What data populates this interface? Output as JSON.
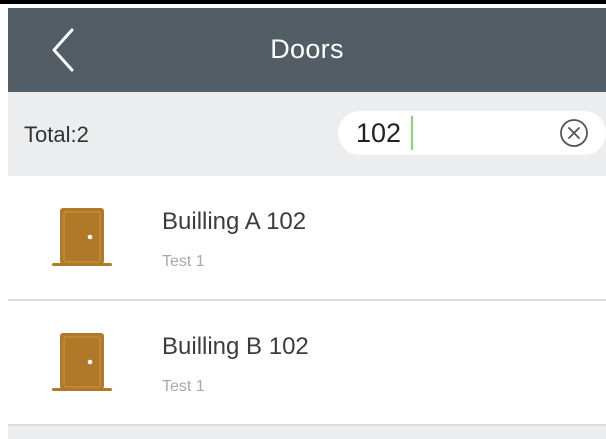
{
  "header": {
    "title": "Doors",
    "back_icon": "chevron-left-icon",
    "background": "#525d66"
  },
  "search": {
    "total_label": "Total:2",
    "query": "102",
    "clear_icon": "clear-circle-x-icon"
  },
  "doors": [
    {
      "name": "Builling A 102",
      "subtitle": "Test 1",
      "icon": "door-icon"
    },
    {
      "name": "Builling B 102",
      "subtitle": "Test 1",
      "icon": "door-icon"
    }
  ],
  "colors": {
    "door": "#b0792a",
    "caret": "#7ddc6a",
    "search_bar_bg": "#ebedee"
  }
}
